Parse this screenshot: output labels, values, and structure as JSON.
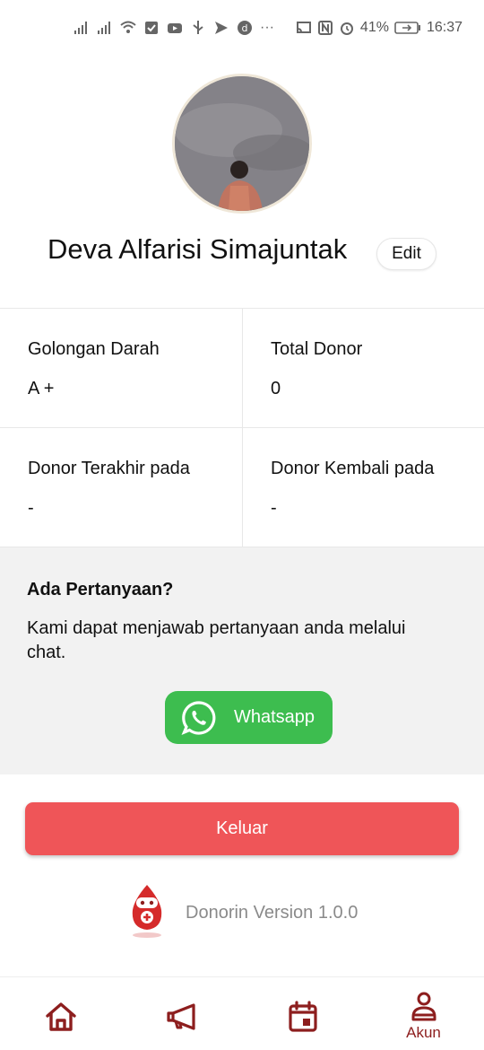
{
  "status_bar": {
    "battery": "41%",
    "time": "16:37",
    "more": "···"
  },
  "profile": {
    "name": "Deva Alfarisi Simajuntak",
    "edit_label": "Edit"
  },
  "stats": [
    {
      "label": "Golongan Darah",
      "value": "A +"
    },
    {
      "label": "Total Donor",
      "value": "0"
    },
    {
      "label": "Donor Terakhir pada",
      "value": "-"
    },
    {
      "label": "Donor Kembali pada",
      "value": "-"
    }
  ],
  "question": {
    "title": "Ada Pertanyaan?",
    "text": "Kami dapat menjawab pertanyaan anda melalui chat.",
    "whatsapp_label": "Whatsapp"
  },
  "logout_label": "Keluar",
  "version_text": "Donorin Version 1.0.0",
  "bottom_nav": {
    "items": [
      {
        "icon": "home-icon"
      },
      {
        "icon": "megaphone-icon"
      },
      {
        "icon": "calendar-icon"
      },
      {
        "icon": "account-icon",
        "label": "Akun",
        "active": true
      }
    ]
  },
  "colors": {
    "accent": "#8d1e1e",
    "logout": "#ef5558",
    "whatsapp": "#3dbd4f",
    "section_bg": "#f2f2f2"
  }
}
